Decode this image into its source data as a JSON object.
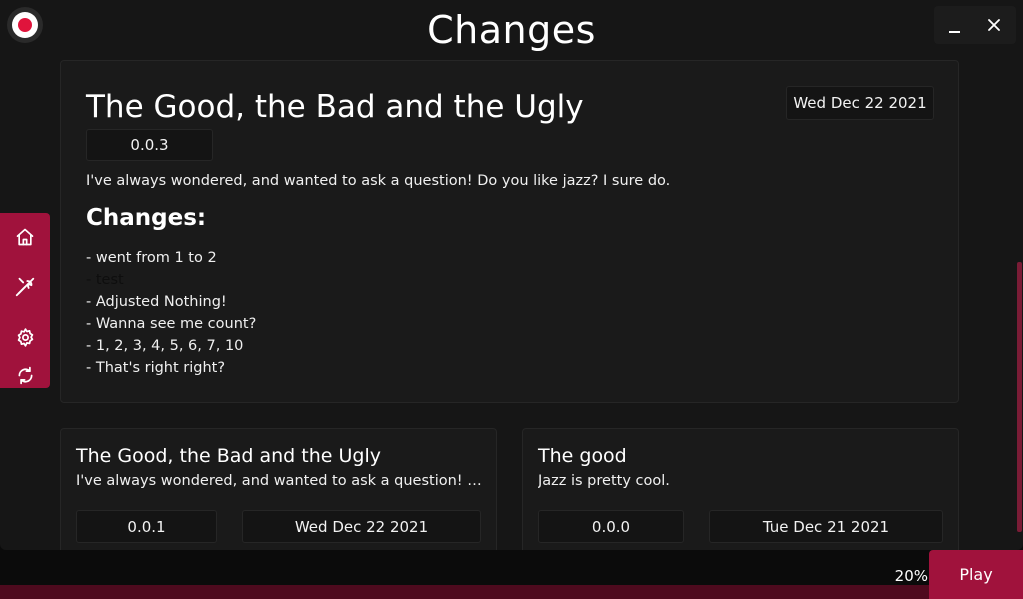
{
  "header": {
    "title": "Changes",
    "minimize_icon": "minimize-icon",
    "close_icon": "close-icon"
  },
  "sidebar": {
    "items": [
      {
        "name": "home",
        "icon": "home-icon"
      },
      {
        "name": "mods",
        "icon": "wrench-off-icon"
      },
      {
        "name": "settings",
        "icon": "gear-icon"
      },
      {
        "name": "refresh",
        "icon": "refresh-icon"
      }
    ]
  },
  "main_entry": {
    "title": "The Good, the Bad and the Ugly",
    "date": "Wed Dec 22 2021",
    "version": "0.0.3",
    "description": "I've always wondered, and wanted to ask a question! Do you like jazz? I sure do.",
    "changes_heading": "Changes:",
    "changes": [
      "- went from 1 to 2",
      "- test",
      "- Adjusted Nothing!",
      "- Wanna see me count?",
      "- 1, 2, 3, 4, 5, 6, 7, 10",
      "- That's right right?"
    ]
  },
  "entries": [
    {
      "title": "The Good, the Bad and the Ugly",
      "description": "I've always wondered, and wanted to ask a question! D...",
      "version": "0.0.1",
      "date": "Wed Dec 22 2021"
    },
    {
      "title": "The good",
      "description": "Jazz is pretty cool.",
      "version": "0.0.0",
      "date": "Tue Dec 21 2021"
    }
  ],
  "footer": {
    "progress_text": "20%",
    "progress": 0.2,
    "play_label": "Play"
  },
  "colors": {
    "accent": "#a0123c",
    "background": "#161616",
    "card": "#1a1a1a",
    "logo_dot": "#e0143c"
  }
}
